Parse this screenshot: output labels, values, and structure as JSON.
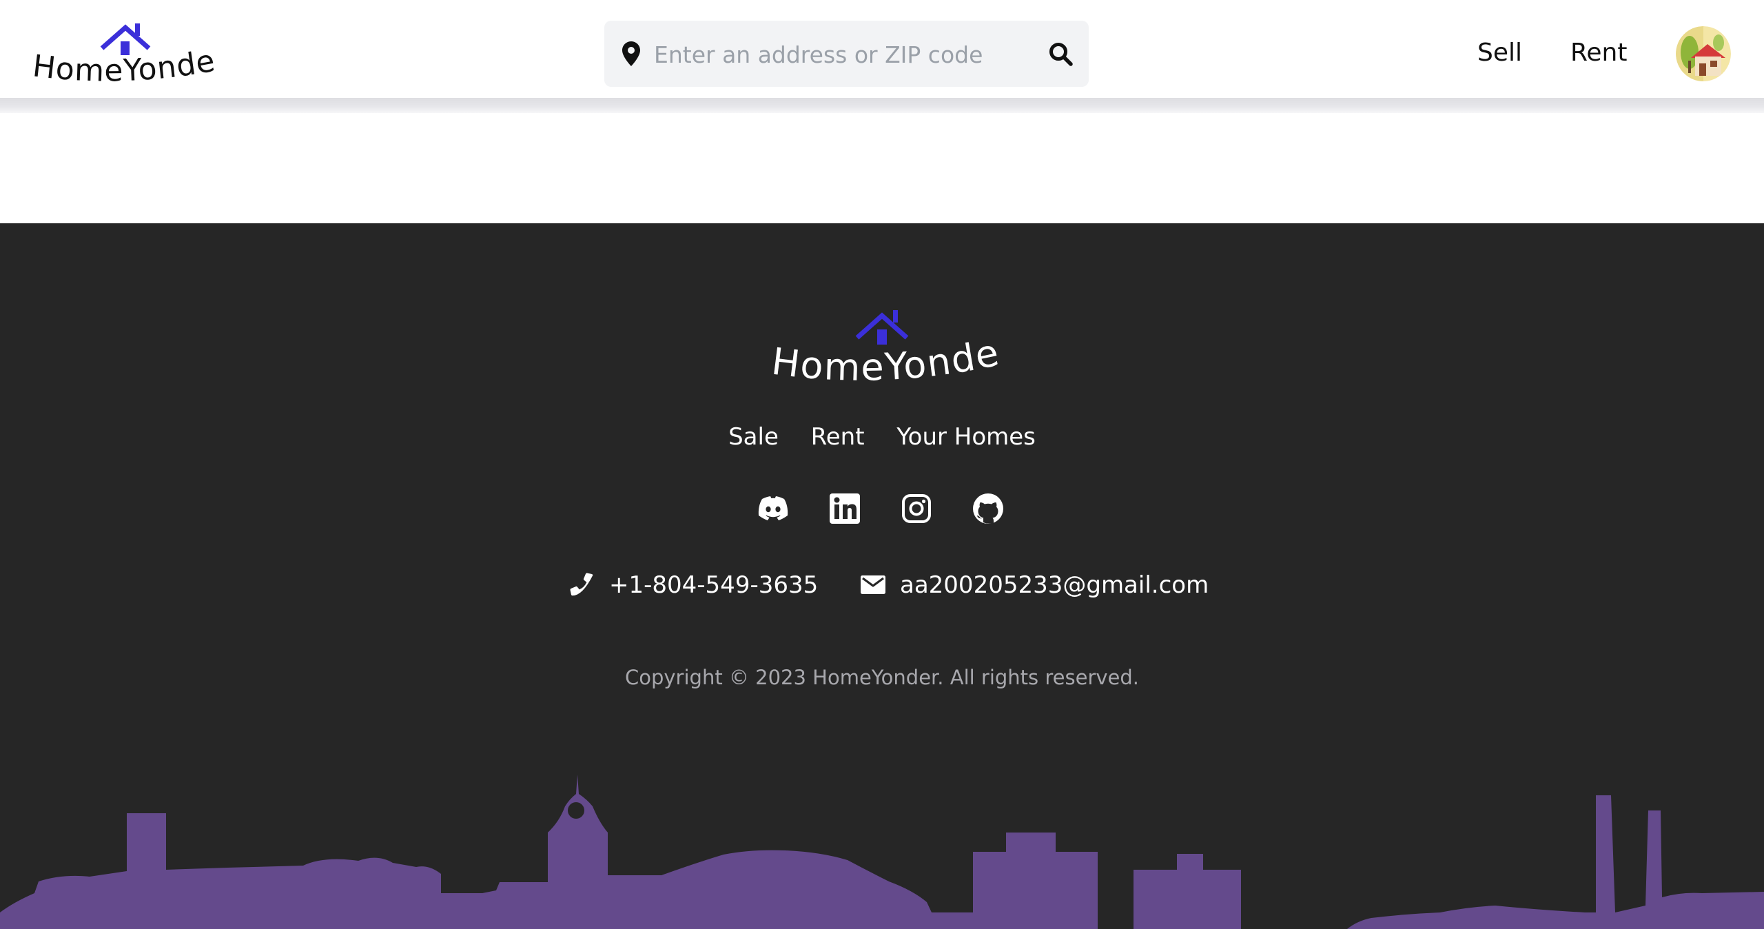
{
  "app": {
    "brand": "HomeYonder",
    "accent_color": "#3b2fd9",
    "footer_bg": "#262626",
    "skyline_color": "#644a8c"
  },
  "header": {
    "search": {
      "placeholder": "Enter an address or ZIP code",
      "value": "",
      "left_icon": "location-pin-icon",
      "right_icon": "search-icon"
    },
    "nav": [
      {
        "label": "Sell"
      },
      {
        "label": "Rent"
      }
    ],
    "avatar_icon": "house-avatar-icon"
  },
  "footer": {
    "links": [
      {
        "label": "Sale"
      },
      {
        "label": "Rent"
      },
      {
        "label": "Your Homes"
      }
    ],
    "socials": [
      "discord-icon",
      "linkedin-icon",
      "instagram-icon",
      "github-icon"
    ],
    "phone": "+1-804-549-3635",
    "email": "aa200205233@gmail.com",
    "copyright": "Copyright © 2023 HomeYonder. All rights reserved."
  }
}
